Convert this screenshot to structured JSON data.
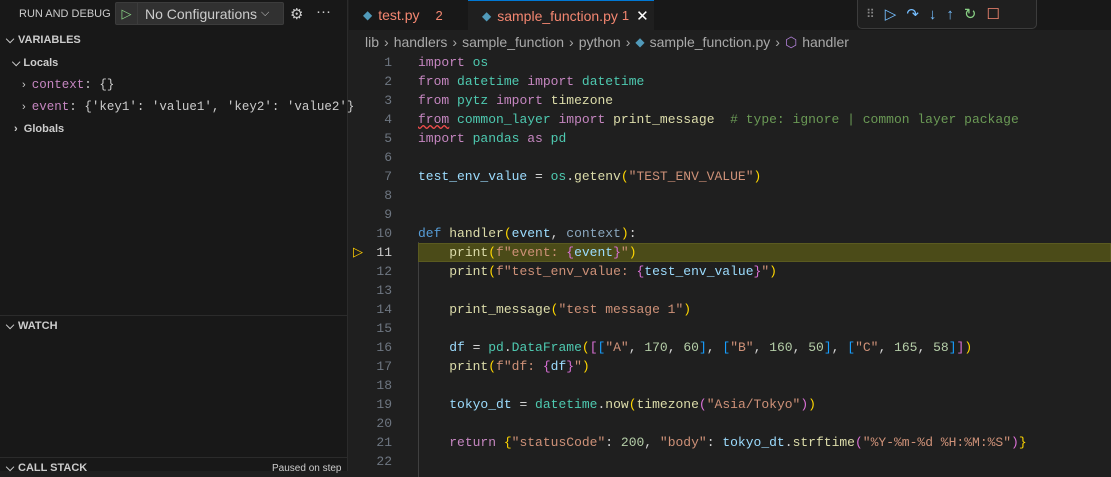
{
  "sidebar": {
    "title": "RUN AND DEBUG",
    "config": "No Configurations",
    "variables": "VARIABLES",
    "locals": "Locals",
    "vars": [
      {
        "name": "context",
        "value": "{}"
      },
      {
        "name": "event",
        "value": "{'key1': 'value1', 'key2': 'value2'}"
      }
    ],
    "globals": "Globals",
    "watch": "WATCH",
    "callstack": "CALL STACK",
    "paused": "Paused on step"
  },
  "tabs": [
    {
      "label": "test.py",
      "badge": "2"
    },
    {
      "label": "sample_function.py",
      "badge": "1"
    }
  ],
  "breadcrumb": [
    "lib",
    "handlers",
    "sample_function",
    "python",
    "sample_function.py",
    "handler"
  ],
  "current_line": 11,
  "code": [
    [
      [
        "import",
        "k"
      ],
      [
        " ",
        "p"
      ],
      [
        "os",
        "m"
      ]
    ],
    [
      [
        "from",
        "k"
      ],
      [
        " ",
        "p"
      ],
      [
        "datetime",
        "m"
      ],
      [
        " ",
        "p"
      ],
      [
        "import",
        "k"
      ],
      [
        " ",
        "p"
      ],
      [
        "datetime",
        "m"
      ]
    ],
    [
      [
        "from",
        "k"
      ],
      [
        " ",
        "p"
      ],
      [
        "pytz",
        "m"
      ],
      [
        " ",
        "p"
      ],
      [
        "import",
        "k"
      ],
      [
        " ",
        "p"
      ],
      [
        "timezone",
        "f"
      ]
    ],
    [
      [
        "from",
        "k"
      ],
      [
        " ",
        "p"
      ],
      [
        "common_layer",
        "m"
      ],
      [
        " ",
        "p"
      ],
      [
        "import",
        "k"
      ],
      [
        " ",
        "p"
      ],
      [
        "print_message",
        "f"
      ],
      [
        "  # type: ignore | common layer package",
        "c"
      ]
    ],
    [
      [
        "import",
        "k"
      ],
      [
        " ",
        "p"
      ],
      [
        "pandas",
        "m"
      ],
      [
        " ",
        "p"
      ],
      [
        "as",
        "k"
      ],
      [
        " ",
        "p"
      ],
      [
        "pd",
        "m"
      ]
    ],
    [],
    [
      [
        "test_env_value",
        "v"
      ],
      [
        " = ",
        "p"
      ],
      [
        "os",
        "m"
      ],
      [
        ".",
        "p"
      ],
      [
        "getenv",
        "f"
      ],
      [
        "(",
        "b1"
      ],
      [
        "\"TEST_ENV_VALUE\"",
        "s"
      ],
      [
        ")",
        "b1"
      ]
    ],
    [],
    [],
    [
      [
        "def",
        "d"
      ],
      [
        " ",
        "p"
      ],
      [
        "handler",
        "f"
      ],
      [
        "(",
        "b1"
      ],
      [
        "event",
        "v"
      ],
      [
        ", ",
        "p"
      ],
      [
        "context",
        "dim"
      ],
      [
        ")",
        "b1"
      ],
      [
        ":",
        "p"
      ]
    ],
    [
      [
        "    ",
        "p"
      ],
      [
        "print",
        "f"
      ],
      [
        "(",
        "b1"
      ],
      [
        "f\"event: ",
        "s"
      ],
      [
        "{",
        "b2"
      ],
      [
        "event",
        "v"
      ],
      [
        "}",
        "b2"
      ],
      [
        "\"",
        "s"
      ],
      [
        ")",
        "b1"
      ]
    ],
    [
      [
        "    ",
        "p"
      ],
      [
        "print",
        "f"
      ],
      [
        "(",
        "b1"
      ],
      [
        "f\"test_env_value: ",
        "s"
      ],
      [
        "{",
        "b2"
      ],
      [
        "test_env_value",
        "v"
      ],
      [
        "}",
        "b2"
      ],
      [
        "\"",
        "s"
      ],
      [
        ")",
        "b1"
      ]
    ],
    [],
    [
      [
        "    ",
        "p"
      ],
      [
        "print_message",
        "f"
      ],
      [
        "(",
        "b1"
      ],
      [
        "\"test message 1\"",
        "s"
      ],
      [
        ")",
        "b1"
      ]
    ],
    [],
    [
      [
        "    ",
        "p"
      ],
      [
        "df",
        "v"
      ],
      [
        " = ",
        "p"
      ],
      [
        "pd",
        "m"
      ],
      [
        ".",
        "p"
      ],
      [
        "DataFrame",
        "m"
      ],
      [
        "(",
        "b1"
      ],
      [
        "[",
        "b2"
      ],
      [
        "[",
        "b3"
      ],
      [
        "\"A\"",
        "s"
      ],
      [
        ", ",
        "p"
      ],
      [
        "170",
        "n"
      ],
      [
        ", ",
        "p"
      ],
      [
        "60",
        "n"
      ],
      [
        "]",
        "b3"
      ],
      [
        ", ",
        "p"
      ],
      [
        "[",
        "b3"
      ],
      [
        "\"B\"",
        "s"
      ],
      [
        ", ",
        "p"
      ],
      [
        "160",
        "n"
      ],
      [
        ", ",
        "p"
      ],
      [
        "50",
        "n"
      ],
      [
        "]",
        "b3"
      ],
      [
        ", ",
        "p"
      ],
      [
        "[",
        "b3"
      ],
      [
        "\"C\"",
        "s"
      ],
      [
        ", ",
        "p"
      ],
      [
        "165",
        "n"
      ],
      [
        ", ",
        "p"
      ],
      [
        "58",
        "n"
      ],
      [
        "]",
        "b3"
      ],
      [
        "]",
        "b2"
      ],
      [
        ")",
        "b1"
      ]
    ],
    [
      [
        "    ",
        "p"
      ],
      [
        "print",
        "f"
      ],
      [
        "(",
        "b1"
      ],
      [
        "f\"df: ",
        "s"
      ],
      [
        "{",
        "b2"
      ],
      [
        "df",
        "v"
      ],
      [
        "}",
        "b2"
      ],
      [
        "\"",
        "s"
      ],
      [
        ")",
        "b1"
      ]
    ],
    [],
    [
      [
        "    ",
        "p"
      ],
      [
        "tokyo_dt",
        "v"
      ],
      [
        " = ",
        "p"
      ],
      [
        "datetime",
        "m"
      ],
      [
        ".",
        "p"
      ],
      [
        "now",
        "f"
      ],
      [
        "(",
        "b1"
      ],
      [
        "timezone",
        "f"
      ],
      [
        "(",
        "b2"
      ],
      [
        "\"Asia/Tokyo\"",
        "s"
      ],
      [
        ")",
        "b2"
      ],
      [
        ")",
        "b1"
      ]
    ],
    [],
    [
      [
        "    ",
        "p"
      ],
      [
        "return",
        "k"
      ],
      [
        " ",
        "p"
      ],
      [
        "{",
        "b1"
      ],
      [
        "\"statusCode\"",
        "s"
      ],
      [
        ": ",
        "p"
      ],
      [
        "200",
        "n"
      ],
      [
        ", ",
        "p"
      ],
      [
        "\"body\"",
        "s"
      ],
      [
        ": ",
        "p"
      ],
      [
        "tokyo_dt",
        "v"
      ],
      [
        ".",
        "p"
      ],
      [
        "strftime",
        "f"
      ],
      [
        "(",
        "b2"
      ],
      [
        "\"%Y-%m-%d %H:%M:%S\"",
        "s"
      ],
      [
        ")",
        "b2"
      ],
      [
        "}",
        "b1"
      ]
    ],
    []
  ]
}
